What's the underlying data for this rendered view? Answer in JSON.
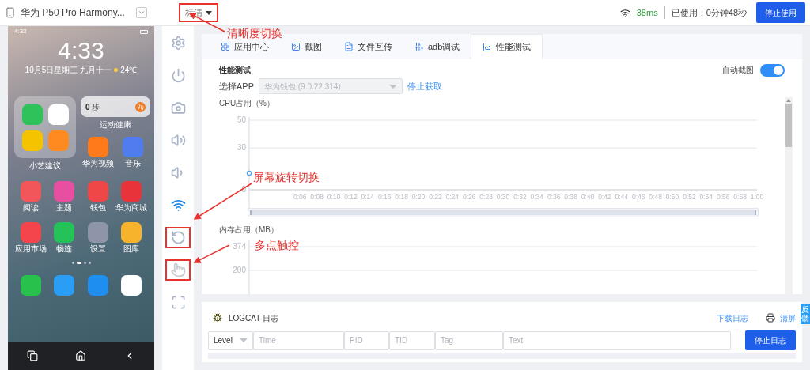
{
  "device": {
    "name": "华为 P50 Pro Harmony...",
    "quality": "标清",
    "quality_annotated": true
  },
  "status": {
    "latency": "38ms",
    "used": "已使用：0分钟48秒",
    "stop_button": "停止使用"
  },
  "phone": {
    "status_time": "4:33",
    "clock": "4:33",
    "date": "10月5日星期三",
    "lunar": "九月十一",
    "weather": "24℃",
    "folder": {
      "label": "小艺建议",
      "apps": [
        {
          "color": "#2fc25b"
        },
        {
          "color": "#ffffff"
        },
        {
          "color": "#f5c400"
        },
        {
          "color": "#ff8a1f"
        }
      ]
    },
    "widget": {
      "count": "0",
      "unit": "步",
      "label": "运动健康"
    },
    "side_apps": [
      {
        "label": "华为视频",
        "color": "#ff7a1a"
      },
      {
        "label": "音乐",
        "color": "#4f7df0"
      }
    ],
    "apps": [
      {
        "label": "阅读",
        "color": "#f2555a"
      },
      {
        "label": "主题",
        "color": "#e94fa0"
      },
      {
        "label": "钱包",
        "color": "#ef4747"
      },
      {
        "label": "华为商城",
        "color": "#e8333a"
      },
      {
        "label": "应用市场",
        "color": "#f4444c"
      },
      {
        "label": "畅连",
        "color": "#25c25a"
      },
      {
        "label": "设置",
        "color": "#8f95a8"
      },
      {
        "label": "图库",
        "color": "#f7b32b"
      }
    ],
    "page_dots": [
      {
        "selected": false
      },
      {
        "selected": true
      },
      {
        "selected": false
      },
      {
        "selected": false
      }
    ],
    "dock": [
      {
        "color": "#27c24c"
      },
      {
        "color": "#2a9df4"
      },
      {
        "color": "#1e8ef0"
      },
      {
        "color": "#ffffff"
      }
    ]
  },
  "tools": [
    {
      "kind": "settings",
      "annotated": false
    },
    {
      "kind": "power",
      "annotated": false
    },
    {
      "kind": "camera",
      "annotated": false
    },
    {
      "kind": "volume-up",
      "annotated": false
    },
    {
      "kind": "volume-down",
      "annotated": false
    },
    {
      "kind": "wifi",
      "annotated": false
    },
    {
      "kind": "rotate",
      "annotated": true
    },
    {
      "kind": "touch",
      "annotated": true
    },
    {
      "kind": "fullscreen",
      "annotated": false
    }
  ],
  "annotations": [
    {
      "text": "清晰度切换"
    },
    {
      "text": "屏幕旋转切换"
    },
    {
      "text": "多点触控"
    }
  ],
  "tabs": [
    {
      "label": "应用中心",
      "selected": false
    },
    {
      "label": "截图",
      "selected": false
    },
    {
      "label": "文件互传",
      "selected": false
    },
    {
      "label": "adb调试",
      "selected": false
    },
    {
      "label": "性能测试",
      "selected": true
    }
  ],
  "perf": {
    "title": "性能测试",
    "select_label": "选择APP",
    "app_value": "华为钱包 (9.0.22.314)",
    "stop_link": "停止获取",
    "auto_label": "自动截图",
    "auto_on": true
  },
  "cpu": {
    "title": "CPU占用（%）",
    "chart_data": {
      "type": "line",
      "xlim": [
        0,
        60
      ],
      "ylim": [
        0,
        50
      ],
      "yticks": [
        0,
        30,
        50
      ],
      "xticks": [
        {
          "value": 6,
          "label": "0:06"
        },
        {
          "value": 8,
          "label": "0:08"
        },
        {
          "value": 10,
          "label": "0:10"
        },
        {
          "value": 12,
          "label": "0:12"
        },
        {
          "value": 14,
          "label": "0:14"
        },
        {
          "value": 16,
          "label": "0:16"
        },
        {
          "value": 18,
          "label": "0:18"
        },
        {
          "value": 20,
          "label": "0:20"
        },
        {
          "value": 22,
          "label": "0:22"
        },
        {
          "value": 24,
          "label": "0:24"
        },
        {
          "value": 26,
          "label": "0:26"
        },
        {
          "value": 28,
          "label": "0:28"
        },
        {
          "value": 30,
          "label": "0:30"
        },
        {
          "value": 32,
          "label": "0:32"
        },
        {
          "value": 34,
          "label": "0:34"
        },
        {
          "value": 36,
          "label": "0:36"
        },
        {
          "value": 38,
          "label": "0:38"
        },
        {
          "value": 40,
          "label": "0:40"
        },
        {
          "value": 42,
          "label": "0:42"
        },
        {
          "value": 44,
          "label": "0:44"
        },
        {
          "value": 46,
          "label": "0:46"
        },
        {
          "value": 48,
          "label": "0:48"
        },
        {
          "value": 50,
          "label": "0:50"
        },
        {
          "value": 52,
          "label": "0:52"
        },
        {
          "value": 54,
          "label": "0:54"
        },
        {
          "value": 56,
          "label": "0:56"
        },
        {
          "value": 58,
          "label": "0:58"
        },
        {
          "value": 60,
          "label": "1:00"
        }
      ],
      "x": [
        0
      ],
      "series": [
        {
          "color": "#4fa3f7",
          "marker": true,
          "values": [
            12
          ]
        }
      ]
    },
    "zoom_slider": {
      "level": 1
    }
  },
  "mem": {
    "title": "内存占用（MB）",
    "axis_labels": [
      "374",
      "200"
    ]
  },
  "logcat": {
    "title": "LOGCAT 日志",
    "download": "下载日志",
    "clear": "清屏",
    "level": "Level",
    "placeholders": [
      "Time",
      "PID",
      "TID",
      "Tag",
      "Text"
    ],
    "button": "停止日志"
  },
  "feedback": "反馈"
}
